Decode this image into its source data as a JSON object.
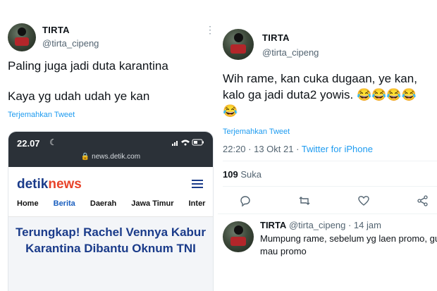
{
  "left_tweet": {
    "author_name": "TIRTA",
    "author_handle": "@tirta_cipeng",
    "more_icon": "more-vertical-icon",
    "text_line1": "Paling juga jadi duta karantina",
    "text_line2": "Kaya yg udah udah ye kan",
    "translate_label": "Terjemahkan Tweet",
    "media": {
      "time": "22.07",
      "status_icons": "signal wifi battery",
      "url": "news.detik.com",
      "logo_part1": "detik",
      "logo_part2": "news",
      "nav_items": [
        "Home",
        "Berita",
        "Daerah",
        "Jawa Timur",
        "Inter"
      ],
      "active_nav": "Berita",
      "headline": "Terungkap! Rachel Vennya Kabur Karantina Dibantu Oknum TNI"
    }
  },
  "right_tweet": {
    "author_name": "TIRTA",
    "author_handle": "@tirta_cipeng",
    "text_line1": "Wih rame, kan cuka dugaan, ye kan,",
    "text_line2": "kalo ga jadi duta2 yowis. 😂😂😂😂",
    "text_line3": "😂",
    "translate_label": "Terjemahkan Tweet",
    "timestamp": "22:20 · 13 Okt 21 · ",
    "client": "Twitter for iPhone",
    "likes_count": "109",
    "likes_label": "Suka",
    "actions": [
      "reply-icon",
      "retweet-icon",
      "like-icon",
      "share-icon"
    ]
  },
  "reply": {
    "author_name": "TIRTA",
    "author_handle": "@tirta_cipeng · 14 jam",
    "text_line1": "Mumpung rame, sebelum yg laen promo, gu",
    "text_line2": "mau promo"
  },
  "colors": {
    "link_blue": "#1d9bf0",
    "detik_blue": "#1a3b8a",
    "detik_red": "#e8432a",
    "muted": "#536471"
  }
}
